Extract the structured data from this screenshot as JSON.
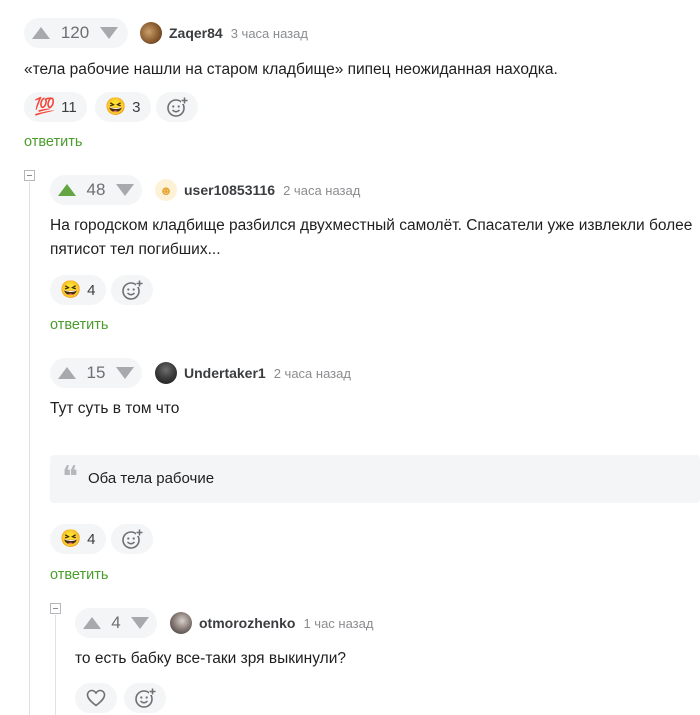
{
  "comments": [
    {
      "votes": "120",
      "upvoted": false,
      "author": "Zaqer84",
      "time": "3 часа назад",
      "text": "«тела рабочие нашли на старом кладбище» пипец неожиданная находка.",
      "reactions": [
        {
          "emoji": "💯",
          "icon": "hundred-points-icon",
          "count": "11"
        },
        {
          "emoji": "😆",
          "icon": "laughing-face-icon",
          "count": "3"
        }
      ],
      "reply_label": "ответить"
    },
    {
      "votes": "48",
      "upvoted": true,
      "author": "user10853116",
      "time": "2 часа назад",
      "text_line1": "На городском кладбище разбился двухместный самолёт. Спасатели уже извлекли более",
      "text_line2": "пятисот тел погибших...",
      "reactions": [
        {
          "emoji": "😆",
          "icon": "laughing-face-icon",
          "count": "4"
        }
      ],
      "reply_label": "ответить"
    },
    {
      "votes": "15",
      "upvoted": false,
      "author": "Undertaker1",
      "time": "2 часа назад",
      "text": "Тут суть в том что",
      "quote": "Оба тела рабочие",
      "reactions": [
        {
          "emoji": "😆",
          "icon": "laughing-face-icon",
          "count": "4"
        }
      ],
      "reply_label": "ответить"
    },
    {
      "votes": "4",
      "upvoted": false,
      "author": "otmorozhenko",
      "time": "1 час назад",
      "text": "то есть бабку все-таки зря выкинули?"
    }
  ],
  "colors": {
    "accent_green": "#64a543",
    "reply_green": "#4a9d2c",
    "pill_bg": "#f4f5f6"
  }
}
